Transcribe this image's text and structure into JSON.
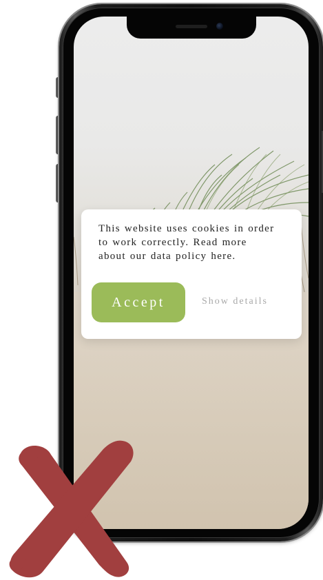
{
  "cookie_dialog": {
    "message": "This website uses cookies in order to work correctly. Read more about our data policy here.",
    "accept_label": "Accept",
    "details_label": "Show details"
  },
  "colors": {
    "accept_button": "#9bbb59",
    "details_link": "#a8a8a8",
    "reject_mark": "#a13f3f",
    "card_background": "#ffffff"
  },
  "icons": {
    "reject_mark": "cross-mark-icon"
  }
}
